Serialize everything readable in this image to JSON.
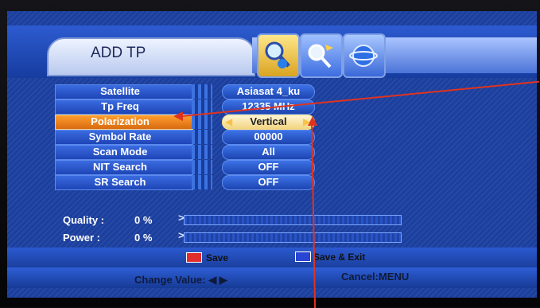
{
  "window": {
    "title": "ADD TP"
  },
  "settings": [
    {
      "label": "Satellite",
      "value": "Asiasat 4_ku"
    },
    {
      "label": "Tp Freq",
      "value": "12335 MHz"
    },
    {
      "label": "Polarization",
      "value": "Vertical"
    },
    {
      "label": "Symbol Rate",
      "value": "00000"
    },
    {
      "label": "Scan Mode",
      "value": "All"
    },
    {
      "label": "NIT Search",
      "value": "OFF"
    },
    {
      "label": "SR Search",
      "value": "OFF"
    }
  ],
  "signal": {
    "quality_label": "Quality :",
    "quality_value": "0 %",
    "quality_percent": 0,
    "power_label": "Power :",
    "power_value": "0 %",
    "power_percent": 0
  },
  "footer": {
    "save_label": "Save",
    "save_exit_label": "Save & Exit",
    "change_value_label": "Change Value: ◀ ▶",
    "cancel_label": "Cancel:MENU"
  },
  "colors": {
    "save_key": "#e22d2d",
    "save_exit_key": "#2a44d4",
    "accent": "#ff9d2e"
  },
  "icons": [
    "satellite-search-icon",
    "satellite-dish-icon",
    "globe-icon"
  ]
}
